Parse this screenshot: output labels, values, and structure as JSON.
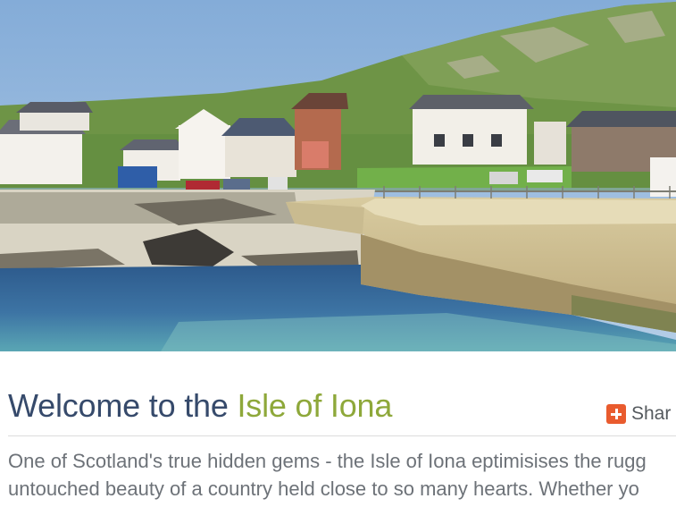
{
  "hero": {
    "image_icon": "coastal-village-photo",
    "colors": {
      "sky": "#8fb6de",
      "hill": "#6f9646",
      "sea": "#2f5f93",
      "quay": "#cbbd92"
    }
  },
  "heading": {
    "prefix": "Welcome to the ",
    "highlight": "Isle of Iona",
    "prefix_color": "#364a6b",
    "highlight_color": "#8ea83a"
  },
  "share": {
    "label": "Shar",
    "icon": "plus-icon",
    "color": "#e95b2e"
  },
  "intro": {
    "line1": "One of Scotland's true hidden gems - the Isle of Iona eptimisises the rugg",
    "line2": "untouched beauty of a country held close to so many hearts. Whether yo"
  }
}
